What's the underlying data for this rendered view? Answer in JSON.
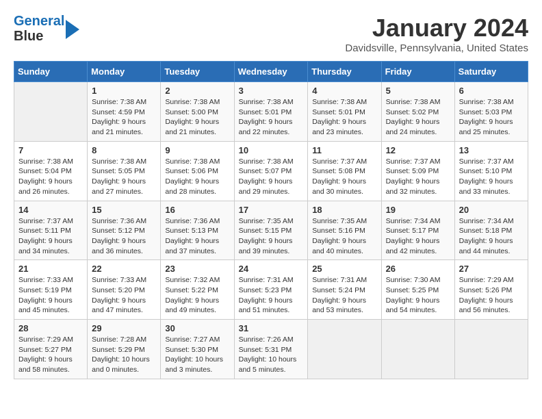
{
  "header": {
    "logo_line1": "General",
    "logo_line2": "Blue",
    "month": "January 2024",
    "location": "Davidsville, Pennsylvania, United States"
  },
  "days_of_week": [
    "Sunday",
    "Monday",
    "Tuesday",
    "Wednesday",
    "Thursday",
    "Friday",
    "Saturday"
  ],
  "weeks": [
    [
      {
        "day": "",
        "info": ""
      },
      {
        "day": "1",
        "info": "Sunrise: 7:38 AM\nSunset: 4:59 PM\nDaylight: 9 hours\nand 21 minutes."
      },
      {
        "day": "2",
        "info": "Sunrise: 7:38 AM\nSunset: 5:00 PM\nDaylight: 9 hours\nand 21 minutes."
      },
      {
        "day": "3",
        "info": "Sunrise: 7:38 AM\nSunset: 5:01 PM\nDaylight: 9 hours\nand 22 minutes."
      },
      {
        "day": "4",
        "info": "Sunrise: 7:38 AM\nSunset: 5:01 PM\nDaylight: 9 hours\nand 23 minutes."
      },
      {
        "day": "5",
        "info": "Sunrise: 7:38 AM\nSunset: 5:02 PM\nDaylight: 9 hours\nand 24 minutes."
      },
      {
        "day": "6",
        "info": "Sunrise: 7:38 AM\nSunset: 5:03 PM\nDaylight: 9 hours\nand 25 minutes."
      }
    ],
    [
      {
        "day": "7",
        "info": "Sunrise: 7:38 AM\nSunset: 5:04 PM\nDaylight: 9 hours\nand 26 minutes."
      },
      {
        "day": "8",
        "info": "Sunrise: 7:38 AM\nSunset: 5:05 PM\nDaylight: 9 hours\nand 27 minutes."
      },
      {
        "day": "9",
        "info": "Sunrise: 7:38 AM\nSunset: 5:06 PM\nDaylight: 9 hours\nand 28 minutes."
      },
      {
        "day": "10",
        "info": "Sunrise: 7:38 AM\nSunset: 5:07 PM\nDaylight: 9 hours\nand 29 minutes."
      },
      {
        "day": "11",
        "info": "Sunrise: 7:37 AM\nSunset: 5:08 PM\nDaylight: 9 hours\nand 30 minutes."
      },
      {
        "day": "12",
        "info": "Sunrise: 7:37 AM\nSunset: 5:09 PM\nDaylight: 9 hours\nand 32 minutes."
      },
      {
        "day": "13",
        "info": "Sunrise: 7:37 AM\nSunset: 5:10 PM\nDaylight: 9 hours\nand 33 minutes."
      }
    ],
    [
      {
        "day": "14",
        "info": "Sunrise: 7:37 AM\nSunset: 5:11 PM\nDaylight: 9 hours\nand 34 minutes."
      },
      {
        "day": "15",
        "info": "Sunrise: 7:36 AM\nSunset: 5:12 PM\nDaylight: 9 hours\nand 36 minutes."
      },
      {
        "day": "16",
        "info": "Sunrise: 7:36 AM\nSunset: 5:13 PM\nDaylight: 9 hours\nand 37 minutes."
      },
      {
        "day": "17",
        "info": "Sunrise: 7:35 AM\nSunset: 5:15 PM\nDaylight: 9 hours\nand 39 minutes."
      },
      {
        "day": "18",
        "info": "Sunrise: 7:35 AM\nSunset: 5:16 PM\nDaylight: 9 hours\nand 40 minutes."
      },
      {
        "day": "19",
        "info": "Sunrise: 7:34 AM\nSunset: 5:17 PM\nDaylight: 9 hours\nand 42 minutes."
      },
      {
        "day": "20",
        "info": "Sunrise: 7:34 AM\nSunset: 5:18 PM\nDaylight: 9 hours\nand 44 minutes."
      }
    ],
    [
      {
        "day": "21",
        "info": "Sunrise: 7:33 AM\nSunset: 5:19 PM\nDaylight: 9 hours\nand 45 minutes."
      },
      {
        "day": "22",
        "info": "Sunrise: 7:33 AM\nSunset: 5:20 PM\nDaylight: 9 hours\nand 47 minutes."
      },
      {
        "day": "23",
        "info": "Sunrise: 7:32 AM\nSunset: 5:22 PM\nDaylight: 9 hours\nand 49 minutes."
      },
      {
        "day": "24",
        "info": "Sunrise: 7:31 AM\nSunset: 5:23 PM\nDaylight: 9 hours\nand 51 minutes."
      },
      {
        "day": "25",
        "info": "Sunrise: 7:31 AM\nSunset: 5:24 PM\nDaylight: 9 hours\nand 53 minutes."
      },
      {
        "day": "26",
        "info": "Sunrise: 7:30 AM\nSunset: 5:25 PM\nDaylight: 9 hours\nand 54 minutes."
      },
      {
        "day": "27",
        "info": "Sunrise: 7:29 AM\nSunset: 5:26 PM\nDaylight: 9 hours\nand 56 minutes."
      }
    ],
    [
      {
        "day": "28",
        "info": "Sunrise: 7:29 AM\nSunset: 5:27 PM\nDaylight: 9 hours\nand 58 minutes."
      },
      {
        "day": "29",
        "info": "Sunrise: 7:28 AM\nSunset: 5:29 PM\nDaylight: 10 hours\nand 0 minutes."
      },
      {
        "day": "30",
        "info": "Sunrise: 7:27 AM\nSunset: 5:30 PM\nDaylight: 10 hours\nand 3 minutes."
      },
      {
        "day": "31",
        "info": "Sunrise: 7:26 AM\nSunset: 5:31 PM\nDaylight: 10 hours\nand 5 minutes."
      },
      {
        "day": "",
        "info": ""
      },
      {
        "day": "",
        "info": ""
      },
      {
        "day": "",
        "info": ""
      }
    ]
  ]
}
